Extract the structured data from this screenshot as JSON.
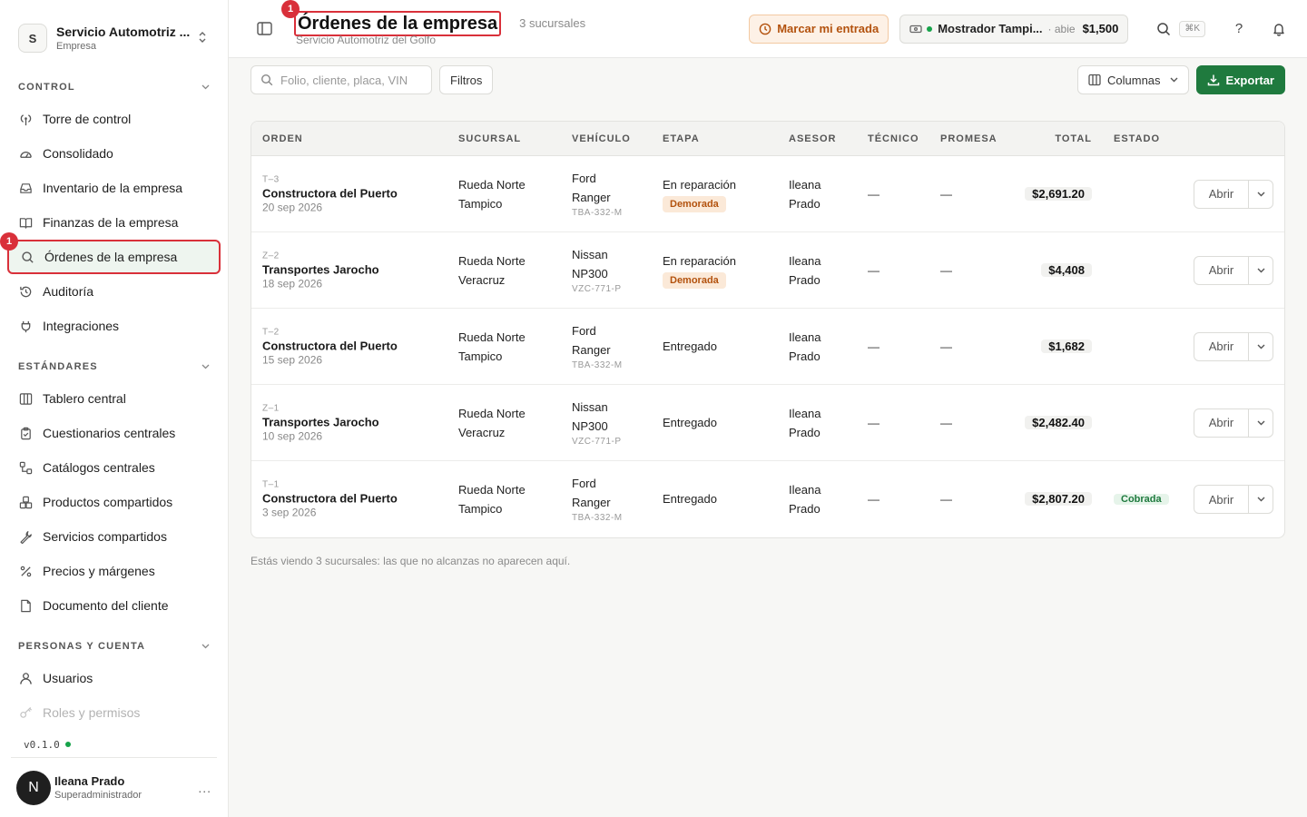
{
  "org": {
    "initial": "S",
    "name": "Servicio Automotriz ...",
    "type": "Empresa"
  },
  "sections": [
    {
      "label": "CONTROL",
      "items": [
        {
          "label": "Torre de control",
          "icon": "antenna-icon"
        },
        {
          "label": "Consolidado",
          "icon": "gauge-icon"
        },
        {
          "label": "Inventario de la empresa",
          "icon": "inbox-icon"
        },
        {
          "label": "Finanzas de la empresa",
          "icon": "book-icon"
        },
        {
          "label": "Órdenes de la empresa",
          "icon": "search-icon"
        },
        {
          "label": "Auditoría",
          "icon": "history-icon"
        },
        {
          "label": "Integraciones",
          "icon": "plug-icon"
        }
      ]
    },
    {
      "label": "ESTÁNDARES",
      "items": [
        {
          "label": "Tablero central",
          "icon": "columns-icon"
        },
        {
          "label": "Cuestionarios centrales",
          "icon": "clipboard-icon"
        },
        {
          "label": "Catálogos centrales",
          "icon": "workflow-icon"
        },
        {
          "label": "Productos compartidos",
          "icon": "boxes-icon"
        },
        {
          "label": "Servicios compartidos",
          "icon": "wrench-icon"
        },
        {
          "label": "Precios y márgenes",
          "icon": "percent-icon"
        },
        {
          "label": "Documento del cliente",
          "icon": "file-icon"
        }
      ]
    },
    {
      "label": "PERSONAS Y CUENTA",
      "items": [
        {
          "label": "Usuarios",
          "icon": "user-icon"
        },
        {
          "label": "Roles y permisos",
          "icon": "key-icon"
        }
      ]
    }
  ],
  "annotation": {
    "number": "1"
  },
  "version": "v0.1.0",
  "user": {
    "initial": "N",
    "name": "Ileana Prado",
    "role": "Superadministrador",
    "more": "..."
  },
  "header": {
    "title": "Órdenes de la empresa",
    "subtitle": "Servicio Automotriz del Golfo",
    "branches": "3 sucursales",
    "mark_label": "Marcar mi entrada",
    "counter_name": "Mostrador Tampi...",
    "counter_state": "· abie",
    "counter_amount": "$1,500",
    "kbd": "⌘K",
    "help": "?"
  },
  "toolbar": {
    "search_placeholder": "Folio, cliente, placa, VIN",
    "filters_label": "Filtros",
    "columns_label": "Columnas",
    "export_label": "Exportar"
  },
  "table": {
    "headers": [
      "ORDEN",
      "SUCURSAL",
      "VEHÍCULO",
      "ETAPA",
      "ASESOR",
      "TÉCNICO",
      "PROMESA",
      "TOTAL",
      "ESTADO"
    ],
    "rows": [
      {
        "folio": "T–3",
        "client": "Constructora del Puerto",
        "date": "20 sep 2026",
        "branch1": "Rueda Norte",
        "branch2": "Tampico",
        "veh1": "Ford",
        "veh2": "Ranger",
        "plate": "TBA-332-M",
        "stage": "En reparación",
        "tag": "Demorada",
        "adv1": "Ileana",
        "adv2": "Prado",
        "tech": "—",
        "promise": "—",
        "total": "$2,691.20",
        "state": "",
        "action": "Abrir"
      },
      {
        "folio": "Z–2",
        "client": "Transportes Jarocho",
        "date": "18 sep 2026",
        "branch1": "Rueda Norte",
        "branch2": "Veracruz",
        "veh1": "Nissan",
        "veh2": "NP300",
        "plate": "VZC-771-P",
        "stage": "En reparación",
        "tag": "Demorada",
        "adv1": "Ileana",
        "adv2": "Prado",
        "tech": "—",
        "promise": "—",
        "total": "$4,408",
        "state": "",
        "action": "Abrir"
      },
      {
        "folio": "T–2",
        "client": "Constructora del Puerto",
        "date": "15 sep 2026",
        "branch1": "Rueda Norte",
        "branch2": "Tampico",
        "veh1": "Ford",
        "veh2": "Ranger",
        "plate": "TBA-332-M",
        "stage": "Entregado",
        "tag": "",
        "adv1": "Ileana",
        "adv2": "Prado",
        "tech": "—",
        "promise": "—",
        "total": "$1,682",
        "state": "",
        "action": "Abrir"
      },
      {
        "folio": "Z–1",
        "client": "Transportes Jarocho",
        "date": "10 sep 2026",
        "branch1": "Rueda Norte",
        "branch2": "Veracruz",
        "veh1": "Nissan",
        "veh2": "NP300",
        "plate": "VZC-771-P",
        "stage": "Entregado",
        "tag": "",
        "adv1": "Ileana",
        "adv2": "Prado",
        "tech": "—",
        "promise": "—",
        "total": "$2,482.40",
        "state": "",
        "action": "Abrir"
      },
      {
        "folio": "T–1",
        "client": "Constructora del Puerto",
        "date": "3 sep 2026",
        "branch1": "Rueda Norte",
        "branch2": "Tampico",
        "veh1": "Ford",
        "veh2": "Ranger",
        "plate": "TBA-332-M",
        "stage": "Entregado",
        "tag": "",
        "adv1": "Ileana",
        "adv2": "Prado",
        "tech": "—",
        "promise": "—",
        "total": "$2,807.20",
        "state": "Cobrada",
        "action": "Abrir"
      }
    ]
  },
  "footnote": "Estás viendo 3 sucursales: las que no alcanzas no aparecen aquí.",
  "colors": {
    "accent": "#1f7a3e",
    "annotation": "#d9303a",
    "warning": "#b3520e"
  }
}
